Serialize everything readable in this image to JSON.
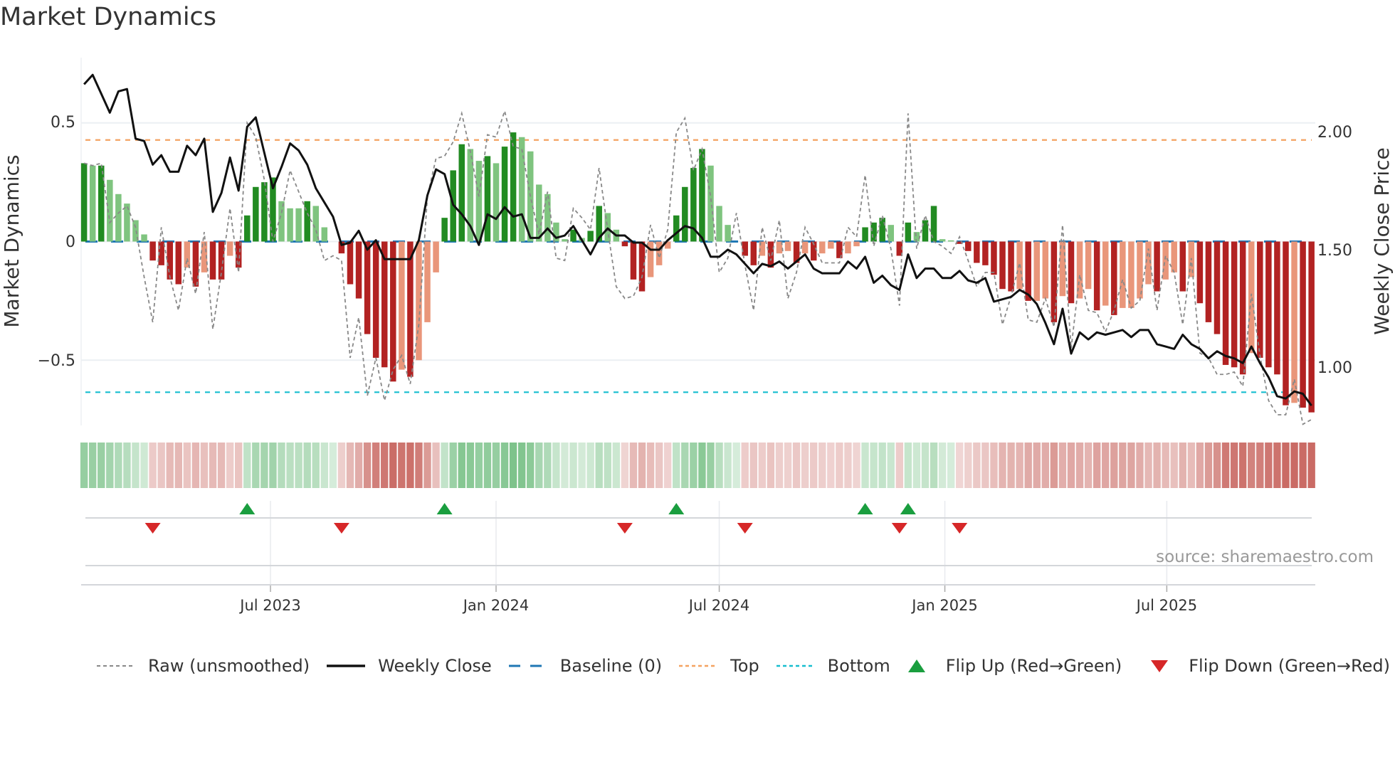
{
  "title": "Market Dynamics",
  "source": "source: sharemaestro.com",
  "chart_data": {
    "type": "bar",
    "title": "Market Dynamics",
    "ylabel": "Market Dynamics",
    "y2label": "Weekly Close Price",
    "ylim": [
      -0.775,
      0.775
    ],
    "y2lim": [
      0.756,
      2.313
    ],
    "yticks": [
      {
        "value": 0.5,
        "label": "0.5"
      },
      {
        "value": 0,
        "label": "0"
      },
      {
        "value": -0.5,
        "label": "−0.5"
      }
    ],
    "y2ticks": [
      {
        "value": 2.0,
        "label": "2.00"
      },
      {
        "value": 1.5,
        "label": "1.50"
      },
      {
        "value": 1.0,
        "label": "1.00"
      }
    ],
    "xticks": [
      {
        "date": "2023-07-01",
        "label": "Jul 2023"
      },
      {
        "date": "2024-01-01",
        "label": "Jan 2024"
      },
      {
        "date": "2024-07-01",
        "label": "Jul 2024"
      },
      {
        "date": "2025-01-01",
        "label": "Jan 2025"
      },
      {
        "date": "2025-07-01",
        "label": "Jul 2025"
      }
    ],
    "start_date": "2023-01-30",
    "interval_days": 7,
    "top_level": 0.428,
    "bottom_level": -0.635,
    "baseline": 0,
    "grid": true,
    "legend_position": "bottom",
    "colors": {
      "strong_up": "#228b22",
      "weak_up": "#7fc47f",
      "strong_down": "#b22222",
      "weak_down": "#e9967a",
      "raw": "#888888",
      "close": "#111111",
      "baseline": "#1f77b4",
      "top": "#f4a261",
      "bottom": "#17becf",
      "flip_up": "#1a9e3f",
      "flip_down": "#d62728",
      "heat_green": "#2e9e44",
      "heat_red": "#b83a32"
    },
    "dynamics": [
      0.33,
      0.32,
      0.32,
      0.26,
      0.2,
      0.16,
      0.09,
      0.03,
      -0.08,
      -0.1,
      -0.16,
      -0.18,
      -0.11,
      -0.19,
      -0.13,
      -0.16,
      -0.16,
      -0.06,
      -0.11,
      0.11,
      0.23,
      0.25,
      0.27,
      0.17,
      0.14,
      0.14,
      0.17,
      0.15,
      0.06,
      0.0,
      -0.05,
      -0.18,
      -0.24,
      -0.39,
      -0.49,
      -0.53,
      -0.59,
      -0.54,
      -0.57,
      -0.5,
      -0.34,
      -0.13,
      0.1,
      0.3,
      0.41,
      0.39,
      0.34,
      0.36,
      0.33,
      0.4,
      0.46,
      0.44,
      0.38,
      0.24,
      0.2,
      0.08,
      0.01,
      0.05,
      0.015,
      0.045,
      0.15,
      0.12,
      0.05,
      -0.02,
      -0.16,
      -0.21,
      -0.15,
      -0.1,
      -0.03,
      0.11,
      0.23,
      0.31,
      0.39,
      0.32,
      0.15,
      0.07,
      0.0,
      -0.06,
      -0.1,
      -0.06,
      -0.11,
      -0.05,
      -0.04,
      -0.09,
      -0.05,
      -0.08,
      -0.05,
      -0.03,
      -0.07,
      -0.05,
      -0.02,
      0.06,
      0.08,
      0.1,
      0.07,
      -0.06,
      0.08,
      0.04,
      0.09,
      0.15,
      0.01,
      0.005,
      -0.01,
      -0.04,
      -0.09,
      -0.1,
      -0.14,
      -0.2,
      -0.21,
      -0.2,
      -0.25,
      -0.25,
      -0.24,
      -0.34,
      -0.23,
      -0.26,
      -0.24,
      -0.2,
      -0.29,
      -0.27,
      -0.31,
      -0.28,
      -0.28,
      -0.24,
      -0.18,
      -0.21,
      -0.16,
      -0.13,
      -0.21,
      -0.15,
      -0.26,
      -0.34,
      -0.39,
      -0.52,
      -0.53,
      -0.56,
      -0.47,
      -0.49,
      -0.53,
      -0.56,
      -0.69,
      -0.68,
      -0.7,
      -0.72
    ],
    "strengthening": [
      1,
      0,
      1,
      0,
      0,
      0,
      0,
      0,
      1,
      1,
      1,
      1,
      0,
      1,
      0,
      1,
      1,
      0,
      1,
      1,
      1,
      1,
      1,
      0,
      0,
      0,
      1,
      0,
      0,
      0,
      1,
      1,
      1,
      1,
      1,
      1,
      1,
      0,
      1,
      0,
      0,
      0,
      1,
      1,
      1,
      0,
      0,
      1,
      0,
      1,
      1,
      0,
      0,
      0,
      0,
      0,
      0,
      1,
      0,
      1,
      1,
      0,
      0,
      1,
      1,
      1,
      0,
      0,
      0,
      1,
      1,
      1,
      1,
      0,
      0,
      0,
      0,
      1,
      1,
      0,
      1,
      0,
      0,
      1,
      0,
      1,
      0,
      0,
      1,
      0,
      0,
      1,
      1,
      1,
      0,
      1,
      1,
      0,
      1,
      1,
      0,
      0,
      1,
      1,
      1,
      1,
      1,
      1,
      1,
      0,
      1,
      0,
      0,
      1,
      0,
      1,
      0,
      0,
      1,
      0,
      1,
      0,
      0,
      0,
      0,
      1,
      0,
      0,
      1,
      0,
      1,
      1,
      1,
      1,
      1,
      1,
      0,
      1,
      1,
      1,
      1,
      0,
      1,
      1
    ],
    "raw": [
      0.33,
      0.32,
      0.33,
      0.08,
      0.12,
      0.15,
      0.06,
      -0.15,
      -0.34,
      0.06,
      -0.15,
      -0.29,
      -0.07,
      -0.22,
      0.04,
      -0.37,
      -0.13,
      0.14,
      -0.13,
      0.5,
      0.44,
      0.26,
      0.0,
      0.12,
      0.3,
      0.21,
      0.12,
      0.05,
      -0.08,
      -0.06,
      -0.08,
      -0.49,
      -0.32,
      -0.65,
      -0.49,
      -0.67,
      -0.54,
      -0.48,
      -0.6,
      -0.35,
      0.19,
      0.35,
      0.36,
      0.42,
      0.54,
      0.38,
      0.19,
      0.45,
      0.44,
      0.55,
      0.4,
      0.39,
      0.19,
      0.03,
      0.21,
      -0.07,
      -0.08,
      0.14,
      0.1,
      0.05,
      0.31,
      0.05,
      -0.19,
      -0.24,
      -0.23,
      -0.15,
      0.07,
      -0.07,
      0.05,
      0.46,
      0.52,
      0.3,
      0.39,
      0.19,
      -0.13,
      -0.07,
      0.12,
      -0.1,
      -0.29,
      0.06,
      -0.08,
      0.09,
      -0.24,
      -0.13,
      0.06,
      -0.01,
      -0.09,
      -0.09,
      -0.09,
      0.06,
      0.02,
      0.28,
      -0.02,
      0.11,
      -0.03,
      -0.27,
      0.54,
      -0.03,
      0.11,
      0.0,
      -0.02,
      -0.05,
      0.02,
      -0.08,
      -0.19,
      -0.13,
      -0.13,
      -0.35,
      -0.23,
      -0.09,
      -0.33,
      -0.34,
      -0.24,
      -0.36,
      0.07,
      -0.45,
      -0.14,
      -0.29,
      -0.3,
      -0.38,
      -0.29,
      -0.16,
      -0.28,
      -0.25,
      -0.03,
      -0.29,
      -0.06,
      -0.13,
      -0.35,
      -0.07,
      -0.47,
      -0.49,
      -0.56,
      -0.56,
      -0.55,
      -0.61,
      -0.22,
      -0.48,
      -0.67,
      -0.73,
      -0.73,
      -0.58,
      -0.77,
      -0.75
    ],
    "close": [
      2.2,
      2.24,
      2.16,
      2.08,
      2.17,
      2.18,
      1.97,
      1.96,
      1.86,
      1.9,
      1.83,
      1.83,
      1.94,
      1.9,
      1.97,
      1.66,
      1.74,
      1.89,
      1.75,
      2.02,
      2.06,
      1.91,
      1.76,
      1.85,
      1.95,
      1.92,
      1.86,
      1.76,
      1.7,
      1.64,
      1.52,
      1.53,
      1.58,
      1.5,
      1.54,
      1.46,
      1.46,
      1.46,
      1.46,
      1.54,
      1.73,
      1.84,
      1.82,
      1.69,
      1.65,
      1.6,
      1.52,
      1.65,
      1.63,
      1.68,
      1.64,
      1.65,
      1.55,
      1.55,
      1.59,
      1.55,
      1.56,
      1.6,
      1.54,
      1.48,
      1.55,
      1.59,
      1.56,
      1.56,
      1.53,
      1.53,
      1.5,
      1.5,
      1.54,
      1.57,
      1.6,
      1.59,
      1.55,
      1.47,
      1.47,
      1.5,
      1.48,
      1.44,
      1.4,
      1.44,
      1.43,
      1.45,
      1.42,
      1.45,
      1.48,
      1.42,
      1.4,
      1.4,
      1.4,
      1.45,
      1.42,
      1.47,
      1.36,
      1.39,
      1.35,
      1.33,
      1.48,
      1.38,
      1.42,
      1.42,
      1.38,
      1.38,
      1.41,
      1.37,
      1.36,
      1.38,
      1.28,
      1.29,
      1.3,
      1.33,
      1.31,
      1.27,
      1.19,
      1.1,
      1.25,
      1.06,
      1.15,
      1.12,
      1.15,
      1.14,
      1.15,
      1.16,
      1.13,
      1.16,
      1.16,
      1.1,
      1.09,
      1.08,
      1.14,
      1.1,
      1.08,
      1.04,
      1.07,
      1.05,
      1.04,
      1.02,
      1.09,
      1.02,
      0.96,
      0.88,
      0.87,
      0.9,
      0.89,
      0.84
    ],
    "flip_up_weeks": [
      19,
      42,
      69,
      91,
      96
    ],
    "flip_down_weeks": [
      8,
      30,
      63,
      77,
      95,
      102
    ],
    "legend": [
      {
        "key": "raw",
        "label": "Raw (unsmoothed)"
      },
      {
        "key": "close",
        "label": "Weekly Close"
      },
      {
        "key": "baseline",
        "label": "Baseline (0)"
      },
      {
        "key": "top",
        "label": "Top"
      },
      {
        "key": "bottom",
        "label": "Bottom"
      },
      {
        "key": "flip_up",
        "label": "Flip Up (Red→Green)"
      },
      {
        "key": "flip_down",
        "label": "Flip Down (Green→Red)"
      }
    ]
  }
}
